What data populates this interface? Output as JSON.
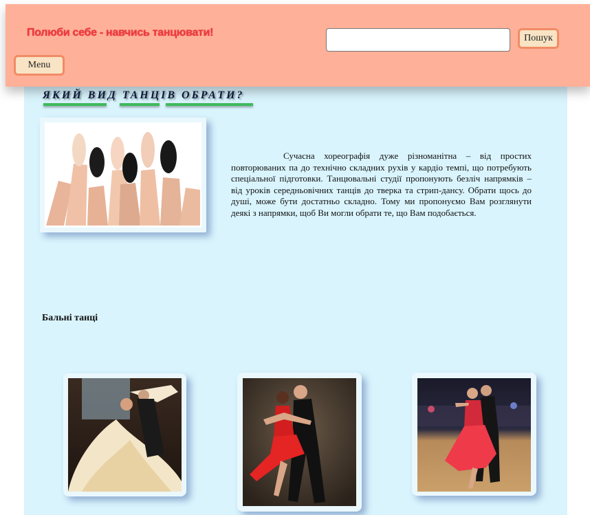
{
  "top_strip": {
    "text": ""
  },
  "header": {
    "slogan": "Полюби себе - навчись танцювати!",
    "search": {
      "value": "",
      "placeholder": ""
    },
    "search_button": "Пошук",
    "menu_button": "Menu"
  },
  "main": {
    "heading": "ЯКИЙ ВИД ТАНЦІВ ОБРАТИ?",
    "intro": "Сучасна хореографія дуже різноманітна – від простих повторюваних па до технічно складних рухів у кардіо темпі, що потребують спеціальної підготовки. Танцювальні студії пропонують безліч напрямків – від уроків середньовічних танців до тверка та стрип-дансу. Обрати щось до душі, може бути достатньо складно. Тому ми пропонуємо Вам розглянути деякі з напрямки, щоб Ви могли обрати те, що Вам подобається.",
    "section_title": "Бальні танці"
  },
  "colors": {
    "header_bg": "#ffb098",
    "content_bg": "#d9f4fd",
    "slogan": "#f0393f",
    "button_border": "#f28b66",
    "heading_underline": "#3fba5c"
  }
}
